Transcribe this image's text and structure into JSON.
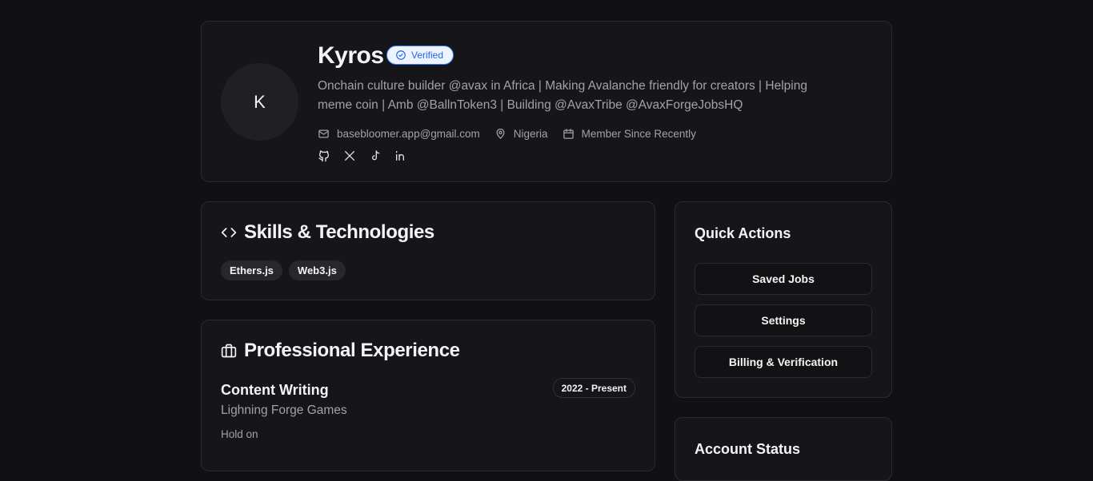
{
  "profile": {
    "avatar_initial": "K",
    "name": "Kyros",
    "verified_label": "Verified",
    "bio": "Onchain culture builder @avax in Africa | Making Avalanche friendly for creators | Helping meme coin | Amb @BallnToken3 | Building @AvaxTribe @AvaxForgeJobsHQ",
    "email": "basebloomer.app@gmail.com",
    "location": "Nigeria",
    "member_since": "Member Since Recently",
    "socials": [
      "github-icon",
      "x-icon",
      "tiktok-icon",
      "linkedin-icon"
    ]
  },
  "skills": {
    "title": "Skills & Technologies",
    "items": [
      "Ethers.js",
      "Web3.js"
    ]
  },
  "experience": {
    "title": "Professional Experience",
    "items": [
      {
        "title": "Content Writing",
        "company": "Lighning Forge Games",
        "description": "Hold on",
        "period": "2022 - Present"
      }
    ]
  },
  "quick_actions": {
    "title": "Quick Actions",
    "buttons": [
      "Saved Jobs",
      "Settings",
      "Billing & Verification"
    ]
  },
  "account_status": {
    "title": "Account Status"
  },
  "colors": {
    "background": "#111114",
    "card": "#16161a",
    "accent": "#2563eb"
  }
}
